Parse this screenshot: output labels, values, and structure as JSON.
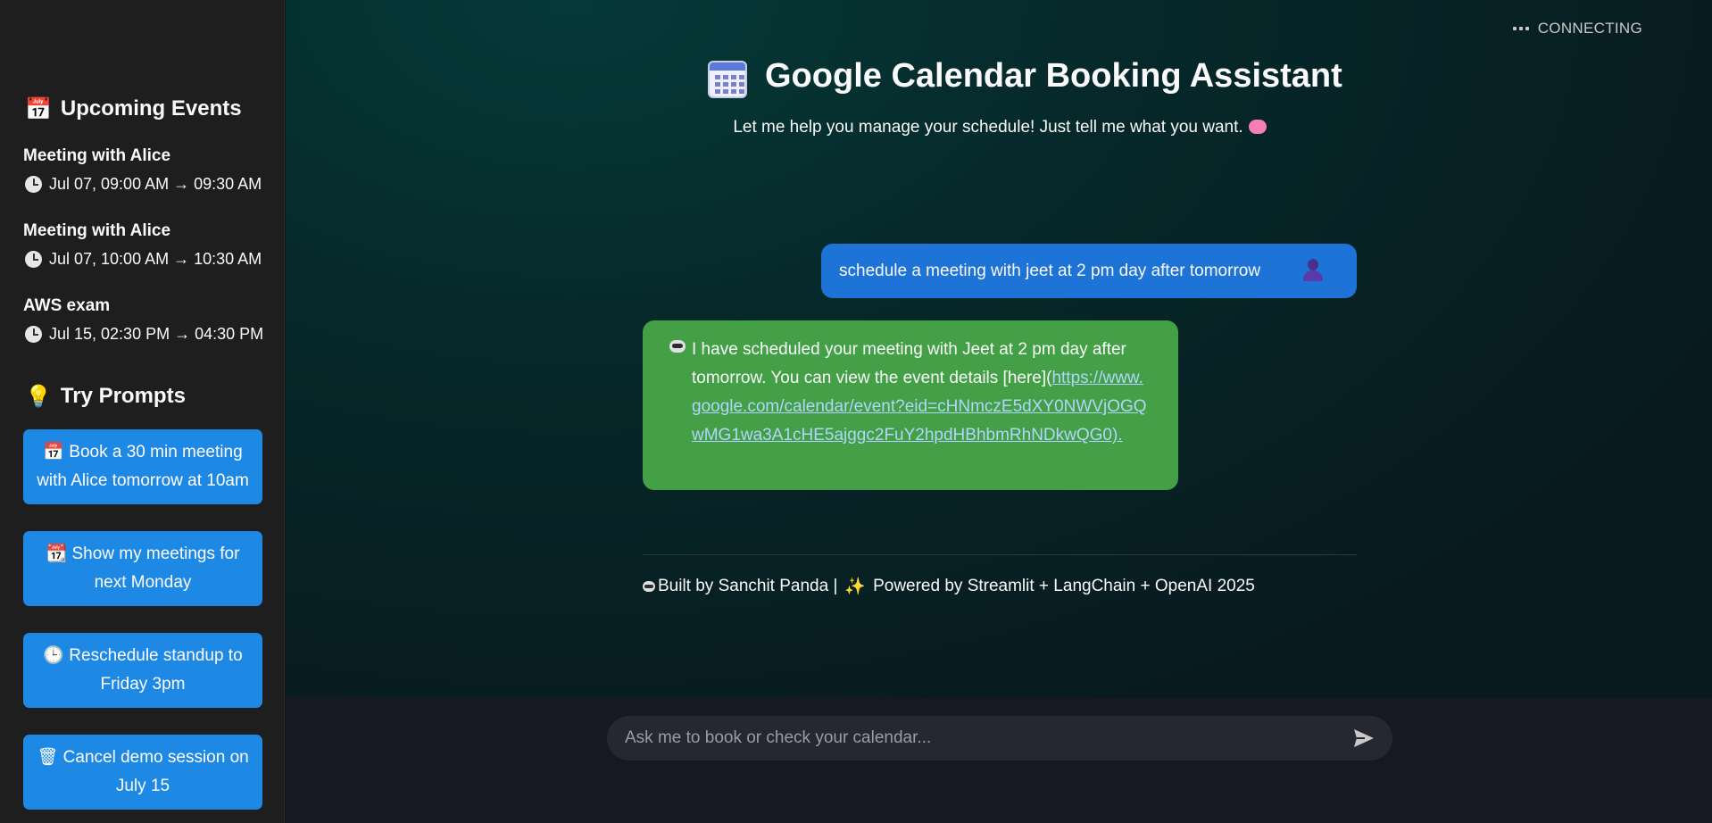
{
  "status": {
    "label": "CONNECTING"
  },
  "sidebar": {
    "upcoming_title": "Upcoming Events",
    "upcoming_icon": "calendar-icon",
    "events": [
      {
        "title": "Meeting with Alice",
        "time": "Jul 07, 09:00 AM → 09:30 AM"
      },
      {
        "title": "Meeting with Alice",
        "time": "Jul 07, 10:00 AM → 10:30 AM"
      },
      {
        "title": "AWS exam",
        "time": "Jul 15, 02:30 PM → 04:30 PM"
      }
    ],
    "prompts_title": "Try Prompts",
    "prompts_icon": "lightbulb-icon",
    "prompts": [
      {
        "label": "Book a 30 min meeting with Alice tomorrow at 10am",
        "icon": "calendar-icon"
      },
      {
        "label": "Show my meetings for next Monday",
        "icon": "calendar-icon"
      },
      {
        "label": "Reschedule standup to Friday 3pm",
        "icon": "clock-icon"
      },
      {
        "label": "Cancel demo session on July 15",
        "icon": "wastebasket-icon"
      }
    ]
  },
  "main": {
    "title": "Google Calendar Booking Assistant",
    "subtitle": "Let me help you manage your schedule! Just tell me what you want.",
    "messages": [
      {
        "role": "user",
        "text": "schedule a meeting with jeet at 2 pm day after tomorrow"
      },
      {
        "role": "assistant",
        "text_before": "I have scheduled your meeting with Jeet at 2 pm day after tomorrow. You can view the event details [here](",
        "link": "https://www.google.com/calendar/event?eid=cHNmczE5dXY0NWVjOGQwMG1wa3A1cHE5ajggc2FuY2hpdHBhbmRhNDkwQG0).",
        "link_text": "https://www.google.com/calendar/event?eid=cHNmczE5dXY0NWVjOGQwMG1wa3A1cHE5ajggc2FuY2hpdHBhbmRhNDkwQG0)."
      }
    ],
    "footer_built": "Built by Sanchit Panda |",
    "footer_powered": "Powered by Streamlit + LangChain + OpenAI 2025"
  },
  "chat_input": {
    "placeholder": "Ask me to book or check your calendar...",
    "value": ""
  },
  "colors": {
    "prompt_button": "#1e88e5",
    "user_bubble": "#1e74d6",
    "assistant_bubble": "#43a047",
    "sidebar_bg": "#1e1e1e"
  }
}
